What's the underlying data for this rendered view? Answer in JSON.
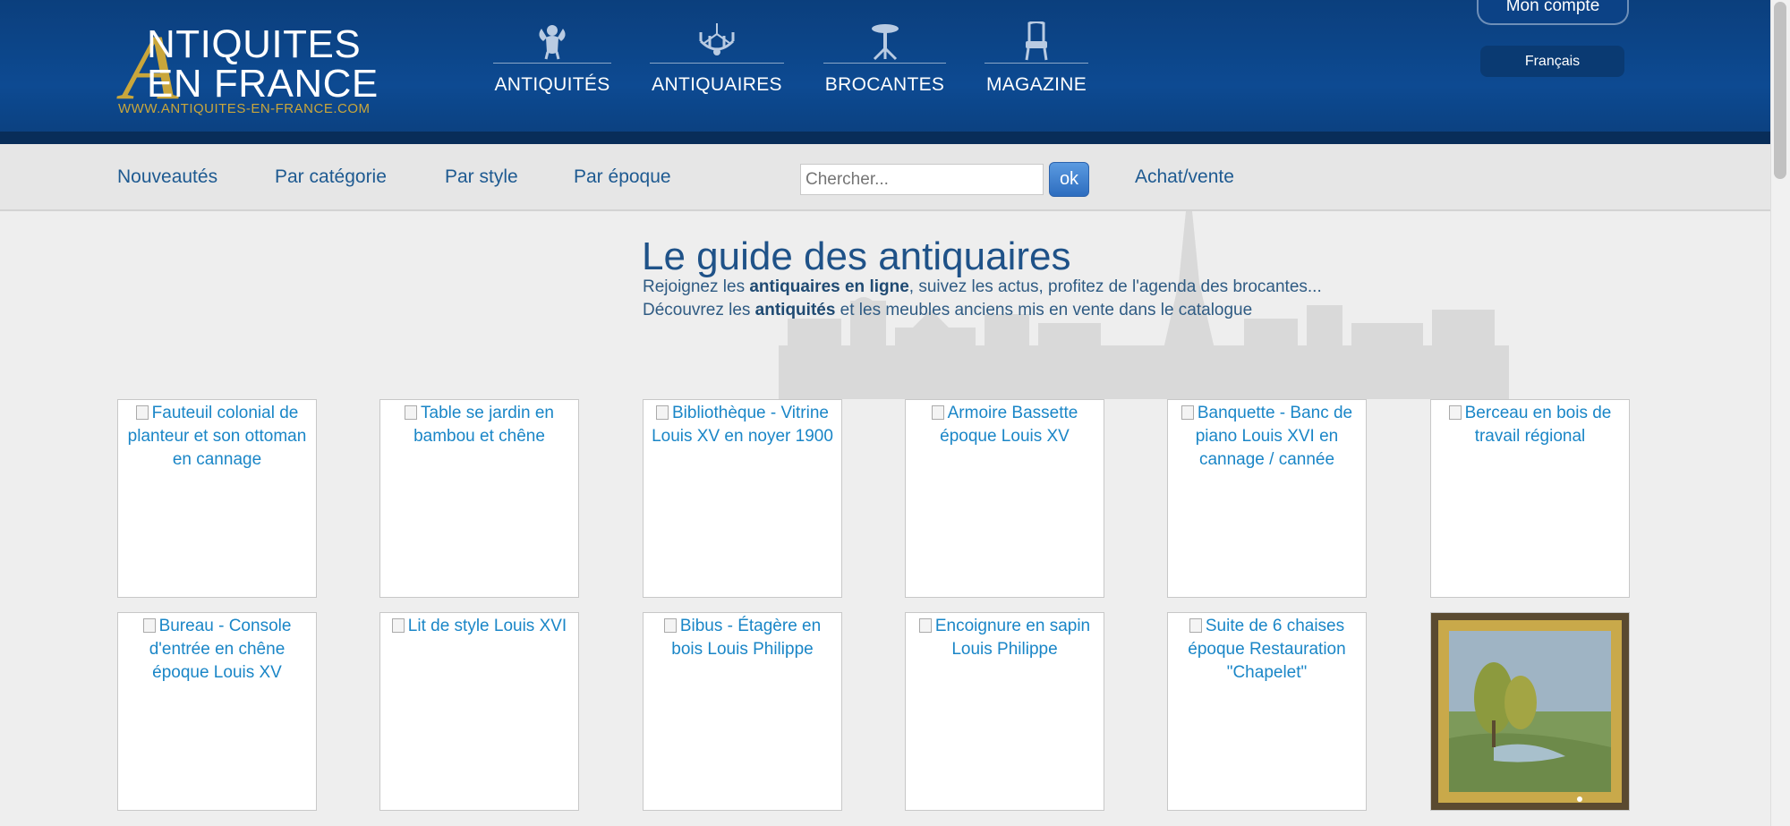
{
  "logo": {
    "big_letter": "A",
    "line1": "NTIQUITES",
    "line2": "EN FRANCE",
    "url": "WWW.ANTIQUITES-EN-FRANCE.COM"
  },
  "nav": [
    {
      "label": "ANTIQUITÉS",
      "icon": "cherub-icon"
    },
    {
      "label": "ANTIQUAIRES",
      "icon": "chandelier-icon"
    },
    {
      "label": "BROCANTES",
      "icon": "gueridon-table-icon"
    },
    {
      "label": "MAGAZINE",
      "icon": "armchair-icon"
    }
  ],
  "account": {
    "label": "Mon compte"
  },
  "language": {
    "label": "Français"
  },
  "subnav": {
    "links": [
      "Nouveautés",
      "Par catégorie",
      "Par style",
      "Par époque"
    ],
    "search_placeholder": "Chercher...",
    "search_button": "ok",
    "buy_sell": "Achat/vente"
  },
  "hero": {
    "title": "Le guide des antiquaires",
    "line1_a": "Rejoignez les ",
    "line1_b": "antiquaires en ligne",
    "line1_c": ", suivez les actus, profitez de l'agenda des brocantes...",
    "line2_a": "Découvrez les ",
    "line2_b": "antiquités",
    "line2_c": " et les meubles anciens mis en vente dans le catalogue"
  },
  "products": [
    "Fauteuil colonial de planteur et son ottoman en cannage",
    "Table se jardin en bambou et chêne",
    "Bibliothèque - Vitrine Louis XV en noyer 1900",
    "Armoire Bassette époque Louis XV",
    "Banquette - Banc de piano Louis XVI en cannage / cannée",
    "Berceau en bois de travail régional",
    "Bureau - Console d'entrée en chêne époque Louis XV",
    "Lit de style Louis XVI",
    "Bibus - Étagère en bois Louis Philippe",
    "Encoignure en sapin Louis Philippe",
    "Suite de 6 chaises époque Restauration \"Chapelet\""
  ],
  "colors": {
    "header": "#0d4a92",
    "gold": "#c9a63b",
    "link": "#1a86c7",
    "title": "#1f5288"
  }
}
